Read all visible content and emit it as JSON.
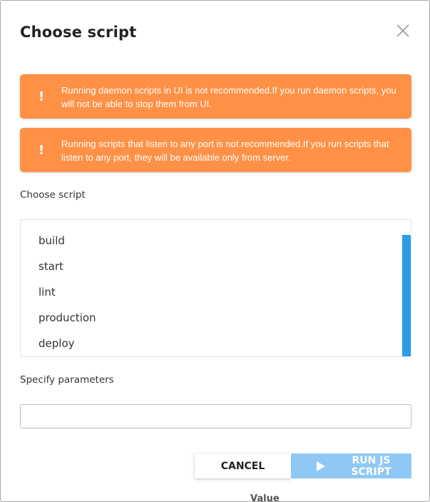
{
  "dialog": {
    "title": "Choose script",
    "close_icon": "close-icon"
  },
  "alerts": [
    {
      "icon": "!",
      "message": "Running daemon scripts in UI is not recommended.If you run daemon scripts, you will not be able to stop them from UI."
    },
    {
      "icon": "!",
      "message": "Running scripts that listen to any port is not recommended.If you run scripts that listen to any port, they will be available only from server."
    }
  ],
  "script_label": "Choose script",
  "scripts": [
    "build",
    "start",
    "lint",
    "production",
    "deploy"
  ],
  "params": {
    "label": "Specify parameters",
    "value": ""
  },
  "buttons": {
    "cancel": "CANCEL",
    "run": "RUN JS SCRIPT"
  },
  "background_text": "Value",
  "colors": {
    "alert": "#ff9147",
    "run_button": "#8fc8f4",
    "scrollbar": "#2d9ce8"
  }
}
